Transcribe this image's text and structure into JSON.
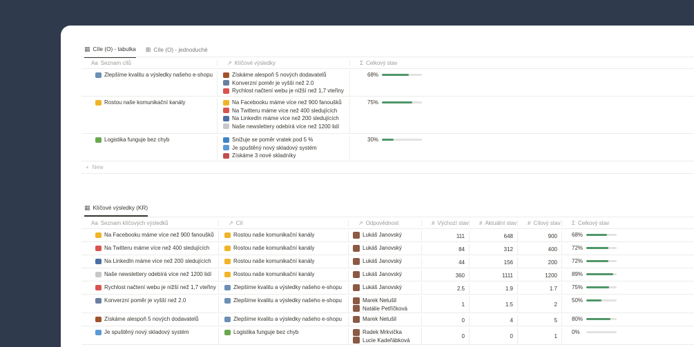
{
  "section1": {
    "tabs": [
      {
        "label": "Cíle (O) - tabulka",
        "icon": "table-icon",
        "active": true
      },
      {
        "label": "Cíle (O) - jednoduché",
        "icon": "grid-icon",
        "active": false
      }
    ],
    "headers": [
      "Seznam cílů",
      "Klíčové výsledky",
      "Celkový stav"
    ],
    "header_icons": [
      "Aa",
      "↗",
      "Σ"
    ],
    "rows": [
      {
        "goal": "Zlepšíme kvalitu a výsledky našeho e-shopu",
        "goal_color": "#6b8fb5",
        "krs": [
          {
            "text": "Získáme alespoň 5 nových dodavatelů",
            "color": "#a0522d"
          },
          {
            "text": "Konverzní poměr je vyšší než 2.0",
            "color": "#6a7fa0"
          },
          {
            "text": "Rychlost načtení webu je nižší než 1,7 vteřiny",
            "color": "#d9534f"
          }
        ],
        "status": "68%",
        "progress": 0.68
      },
      {
        "goal": "Rostou naše komunikační kanály",
        "goal_color": "#f0b429",
        "krs": [
          {
            "text": "Na Facebooku máme více než 900 fanoušků",
            "color": "#f0b429"
          },
          {
            "text": "Na Twitteru máme více než 400 sledujících",
            "color": "#d9534f"
          },
          {
            "text": "Na LinkedIn máme více než 200 sledujících",
            "color": "#4a6fa5"
          },
          {
            "text": "Naše newslettery odebírá více než 1200 lidí",
            "color": "#c8c8c8"
          }
        ],
        "status": "75%",
        "progress": 0.75
      },
      {
        "goal": "Logistika funguje bez chyb",
        "goal_color": "#6aa84f",
        "krs": [
          {
            "text": "Snižuje se poměr vratek pod 5 %",
            "color": "#3d85c6"
          },
          {
            "text": "Je spuštěný nový skladový systém",
            "color": "#5b9bd5"
          },
          {
            "text": "Získáme 3 nové skladníky",
            "color": "#c0504d"
          }
        ],
        "status": "30%",
        "progress": 0.3
      }
    ],
    "new_label": "New"
  },
  "section2": {
    "tab": {
      "label": "Klíčové výsledky (KR)",
      "icon": "table-icon"
    },
    "headers": [
      "Seznam klíčových výsledků",
      "Cíl",
      "Odpovědnost",
      "Výchozí stav",
      "Aktuální stav",
      "Cílový stav",
      "Celkový stav"
    ],
    "header_icons": [
      "Aa",
      "↗",
      "↗",
      "#",
      "#",
      "#",
      "Σ"
    ],
    "rows": [
      {
        "kr": "Na Facebooku máme více než 900 fanoušků",
        "kr_color": "#f0b429",
        "goal": "Rostou naše komunikační kanály",
        "goal_color": "#f0b429",
        "people": [
          "Lukáš Janovský"
        ],
        "start": "111",
        "current": "648",
        "target": "900",
        "status": "68%",
        "progress": 0.68
      },
      {
        "kr": "Na Twitteru máme více než 400 sledujících",
        "kr_color": "#d9534f",
        "goal": "Rostou naše komunikační kanály",
        "goal_color": "#f0b429",
        "people": [
          "Lukáš Janovský"
        ],
        "start": "84",
        "current": "312",
        "target": "400",
        "status": "72%",
        "progress": 0.72
      },
      {
        "kr": "Na LinkedIn máme více než 200 sledujících",
        "kr_color": "#4a6fa5",
        "goal": "Rostou naše komunikační kanály",
        "goal_color": "#f0b429",
        "people": [
          "Lukáš Janovský"
        ],
        "start": "44",
        "current": "156",
        "target": "200",
        "status": "72%",
        "progress": 0.72
      },
      {
        "kr": "Naše newslettery odebírá více než 1200 lidí",
        "kr_color": "#c8c8c8",
        "goal": "Rostou naše komunikační kanály",
        "goal_color": "#f0b429",
        "people": [
          "Lukáš Janovský"
        ],
        "start": "360",
        "current": "1111",
        "target": "1200",
        "status": "89%",
        "progress": 0.89
      },
      {
        "kr": "Rychlost načtení webu je nižší než 1,7 vteřiny",
        "kr_color": "#d9534f",
        "goal": "Zlepšíme kvalitu a výsledky našeho e-shopu",
        "goal_color": "#6b8fb5",
        "people": [
          "Lukáš Janovský"
        ],
        "start": "2.5",
        "current": "1.9",
        "target": "1.7",
        "status": "75%",
        "progress": 0.75
      },
      {
        "kr": "Konverzní poměr je vyšší než 2.0",
        "kr_color": "#6a7fa0",
        "goal": "Zlepšíme kvalitu a výsledky našeho e-shopu",
        "goal_color": "#6b8fb5",
        "people": [
          "Marek Netušil",
          "Natálie Petříčková"
        ],
        "start": "1",
        "current": "1.5",
        "target": "2",
        "status": "50%",
        "progress": 0.5
      },
      {
        "kr": "Získáme alespoň 5 nových dodavatelů",
        "kr_color": "#a0522d",
        "goal": "Zlepšíme kvalitu a výsledky našeho e-shopu",
        "goal_color": "#6b8fb5",
        "people": [
          "Marek Netušil"
        ],
        "start": "0",
        "current": "4",
        "target": "5",
        "status": "80%",
        "progress": 0.8
      },
      {
        "kr": "Je spuštěný nový skladový systém",
        "kr_color": "#5b9bd5",
        "goal": "Logistika funguje bez chyb",
        "goal_color": "#6aa84f",
        "people": [
          "Radek Mrkvička",
          "Lucie Kadeřábková"
        ],
        "start": "0",
        "current": "0",
        "target": "1",
        "status": "0%",
        "progress": 0.0
      }
    ]
  }
}
